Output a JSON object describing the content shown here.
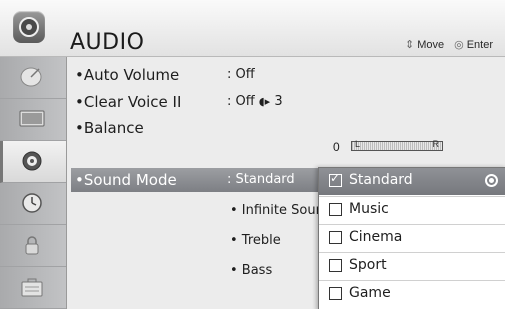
{
  "header": {
    "title": "AUDIO",
    "move_label": "Move",
    "enter_label": "Enter",
    "icon": "speaker-icon"
  },
  "sidebar": {
    "items": [
      {
        "icon": "satellite-dish-icon",
        "active": false
      },
      {
        "icon": "tv-picture-icon",
        "active": false
      },
      {
        "icon": "speaker-icon",
        "active": true
      },
      {
        "icon": "clock-icon",
        "active": false
      },
      {
        "icon": "lock-icon",
        "active": false
      },
      {
        "icon": "options-briefcase-icon",
        "active": false
      }
    ]
  },
  "menu": {
    "rows": [
      {
        "label": "•Auto Volume",
        "value": ": Off"
      },
      {
        "label": "•Clear Voice II",
        "value": ": Off",
        "level": "3"
      },
      {
        "label": "•Balance",
        "value": "0",
        "bar_left": "L",
        "bar_right": "R"
      },
      {
        "label": "•Sound Mode",
        "value": ": Standard"
      }
    ],
    "sub_items": [
      "• Infinite Soun",
      "• Treble",
      "• Bass"
    ]
  },
  "popup": {
    "options": [
      {
        "label": "Standard",
        "checked": true
      },
      {
        "label": "Music",
        "checked": false
      },
      {
        "label": "Cinema",
        "checked": false
      },
      {
        "label": "Sport",
        "checked": false
      },
      {
        "label": "Game",
        "checked": false
      }
    ]
  },
  "colors": {
    "highlight": "#8a8c90",
    "background": "#ececec",
    "sidebar": "#b5b6b8"
  }
}
